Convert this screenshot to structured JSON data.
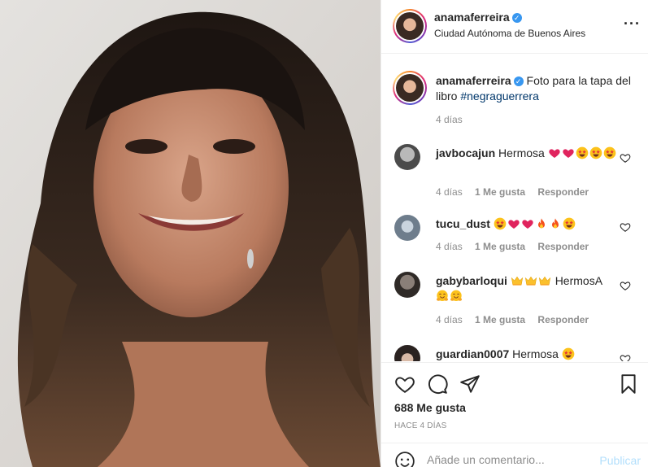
{
  "post": {
    "username": "anamaferreira",
    "location": "Ciudad Autónoma de Buenos Aires",
    "more_icon": "more-horizontal-icon"
  },
  "caption": {
    "username": "anamaferreira",
    "text": "Foto para la tapa del libro",
    "hashtag": "#negraguerrera",
    "time": "4 días"
  },
  "comments": [
    {
      "username": "javbocajun",
      "text": "Hermosa",
      "emojis": [
        "red-heart",
        "red-heart",
        "star-struck",
        "star-struck",
        "star-struck"
      ],
      "time": "4 días",
      "likes": "1 Me gusta",
      "reply": "Responder"
    },
    {
      "username": "tucu_dust",
      "text": "",
      "emojis": [
        "star-struck",
        "red-heart",
        "red-heart",
        "fire",
        "fire",
        "star-struck"
      ],
      "time": "4 días",
      "likes": "1 Me gusta",
      "reply": "Responder"
    },
    {
      "username": "gabybarloqui",
      "text": "HermosA",
      "emojis": [
        "crown",
        "crown",
        "crown",
        "hugging",
        "hugging"
      ],
      "time": "4 días",
      "likes": "1 Me gusta",
      "reply": "Responder"
    },
    {
      "username": "guardian0007",
      "text": "Hermosa",
      "emojis": [
        "star-struck"
      ],
      "time": "",
      "likes": "",
      "reply": ""
    }
  ],
  "actions": {
    "likes": "688 Me gusta",
    "posted": "HACE 4 DÍAS"
  },
  "add_comment": {
    "placeholder": "Añade un comentario...",
    "publish": "Publicar"
  },
  "colors": {
    "verified": "#3897f0",
    "hashtag": "#00376b",
    "secondary_text": "#8e8e8e",
    "publish_disabled": "#b2dffc"
  }
}
